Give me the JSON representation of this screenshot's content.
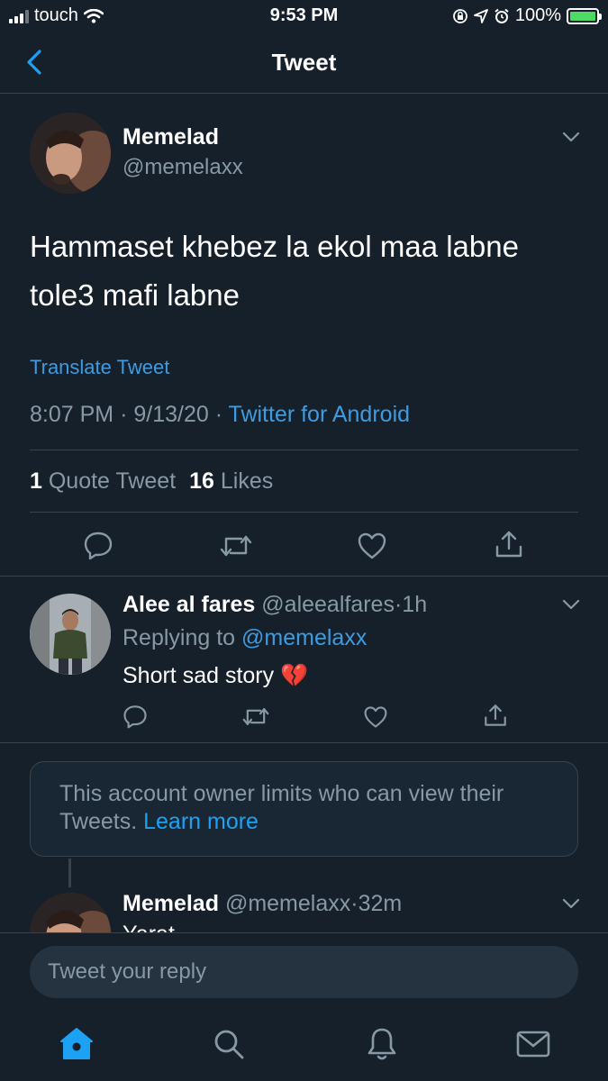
{
  "status_bar": {
    "carrier": "touch",
    "time": "9:53 PM",
    "battery": "100%"
  },
  "header": {
    "title": "Tweet"
  },
  "tweet": {
    "author_name": "Memelad",
    "author_handle": "@memelaxx",
    "text_line1": "Hammaset khebez la ekol maa labne",
    "text_line2": "tole3 mafi labne",
    "translate": "Translate Tweet",
    "time": "8:07 PM",
    "sep1": "·",
    "date": "9/13/20",
    "sep2": "·",
    "source": "Twitter for Android",
    "quote_count": "1",
    "quote_label": "Quote Tweet",
    "like_count": "16",
    "like_label": "Likes"
  },
  "reply": {
    "author_name": "Alee al fares",
    "author_handle": "@aleealfares",
    "sep": "·",
    "age": "1h",
    "replying_prefix": "Replying to",
    "replying_handle": "@memelaxx",
    "text": "Short sad story 💔"
  },
  "notice": {
    "text": "This account owner limits who can view their Tweets.",
    "link": "Learn more"
  },
  "reply2": {
    "author_name": "Memelad",
    "author_handle": "@memelaxx",
    "sep": "·",
    "age": "32m",
    "text": "Yarat"
  },
  "compose": {
    "placeholder": "Tweet your reply"
  },
  "colors": {
    "background": "#15202b",
    "accent": "#1da1f2",
    "muted": "#8899a6",
    "divider": "#38444d"
  },
  "icons": {
    "nav": [
      "home-icon",
      "search-icon",
      "notifications-icon",
      "messages-icon"
    ],
    "actions": [
      "reply-icon",
      "retweet-icon",
      "like-icon",
      "share-icon"
    ]
  }
}
